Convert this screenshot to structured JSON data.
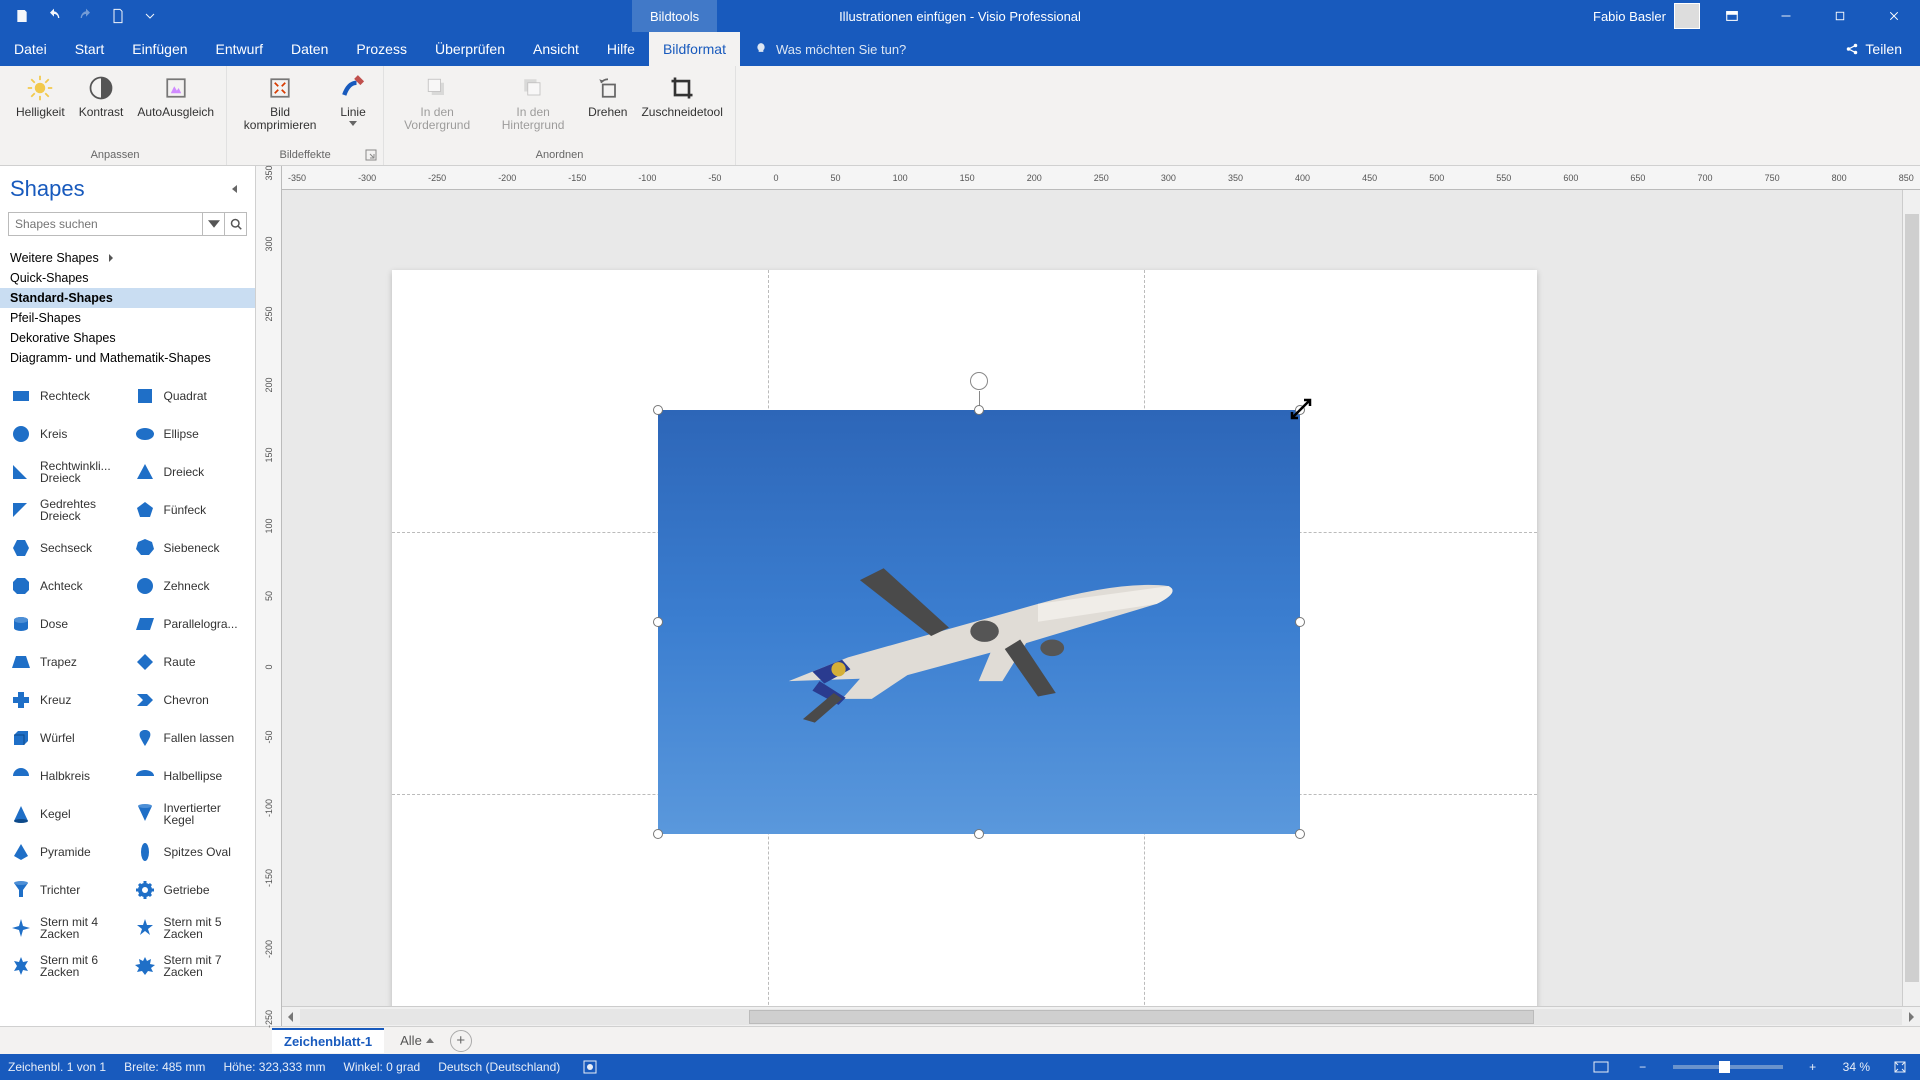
{
  "title": {
    "context_tab": "Bildtools",
    "document": "Illustrationen einfügen  -  Visio Professional",
    "user": "Fabio Basler"
  },
  "tabs": [
    "Datei",
    "Start",
    "Einfügen",
    "Entwurf",
    "Daten",
    "Prozess",
    "Überprüfen",
    "Ansicht",
    "Hilfe",
    "Bildformat"
  ],
  "active_tab": "Bildformat",
  "tell_me": "Was möchten Sie tun?",
  "share": "Teilen",
  "ribbon": {
    "groups": [
      {
        "label": "Anpassen",
        "buttons": [
          "Helligkeit",
          "Kontrast",
          "AutoAusgleich"
        ]
      },
      {
        "label": "Bildeffekte",
        "buttons": [
          "Bild komprimieren",
          "Linie"
        ],
        "has_dialog": true
      },
      {
        "label": "Anordnen",
        "buttons": [
          "In den Vordergrund",
          "In den Hintergrund",
          "Drehen",
          "Zuschneidetool"
        ],
        "disabled": [
          0,
          1
        ]
      }
    ]
  },
  "shapes_panel": {
    "title": "Shapes",
    "search_placeholder": "Shapes suchen",
    "stencils": [
      "Weitere Shapes",
      "Quick-Shapes",
      "Standard-Shapes",
      "Pfeil-Shapes",
      "Dekorative Shapes",
      "Diagramm- und Mathematik-Shapes"
    ],
    "selected_stencil": "Standard-Shapes",
    "shapes": [
      "Rechteck",
      "Quadrat",
      "Kreis",
      "Ellipse",
      "Rechtwinkli... Dreieck",
      "Dreieck",
      "Gedrehtes Dreieck",
      "Fünfeck",
      "Sechseck",
      "Siebeneck",
      "Achteck",
      "Zehneck",
      "Dose",
      "Parallelogra...",
      "Trapez",
      "Raute",
      "Kreuz",
      "Chevron",
      "Würfel",
      "Fallen lassen",
      "Halbkreis",
      "Halbellipse",
      "Kegel",
      "Invertierter Kegel",
      "Pyramide",
      "Spitzes Oval",
      "Trichter",
      "Getriebe",
      "Stern mit 4 Zacken",
      "Stern mit 5 Zacken",
      "Stern mit 6 Zacken",
      "Stern mit 7 Zacken"
    ]
  },
  "hruler_ticks": [
    "-350",
    "-300",
    "-250",
    "-200",
    "-150",
    "-100",
    "-50",
    "0",
    "50",
    "100",
    "150",
    "200",
    "250",
    "300",
    "350",
    "400",
    "450",
    "500",
    "550",
    "600",
    "650",
    "700",
    "750",
    "800",
    "850"
  ],
  "vruler_ticks": [
    "350",
    "300",
    "250",
    "200",
    "150",
    "100",
    "50",
    "0",
    "-50",
    "-100",
    "-150",
    "-200",
    "-250"
  ],
  "sheet": {
    "active": "Zeichenblatt-1",
    "all": "Alle"
  },
  "status": {
    "page": "Zeichenbl. 1 von 1",
    "width": "Breite: 485 mm",
    "height": "Höhe: 323,333 mm",
    "angle": "Winkel: 0 grad",
    "lang": "Deutsch (Deutschland)",
    "zoom": "34 %"
  }
}
